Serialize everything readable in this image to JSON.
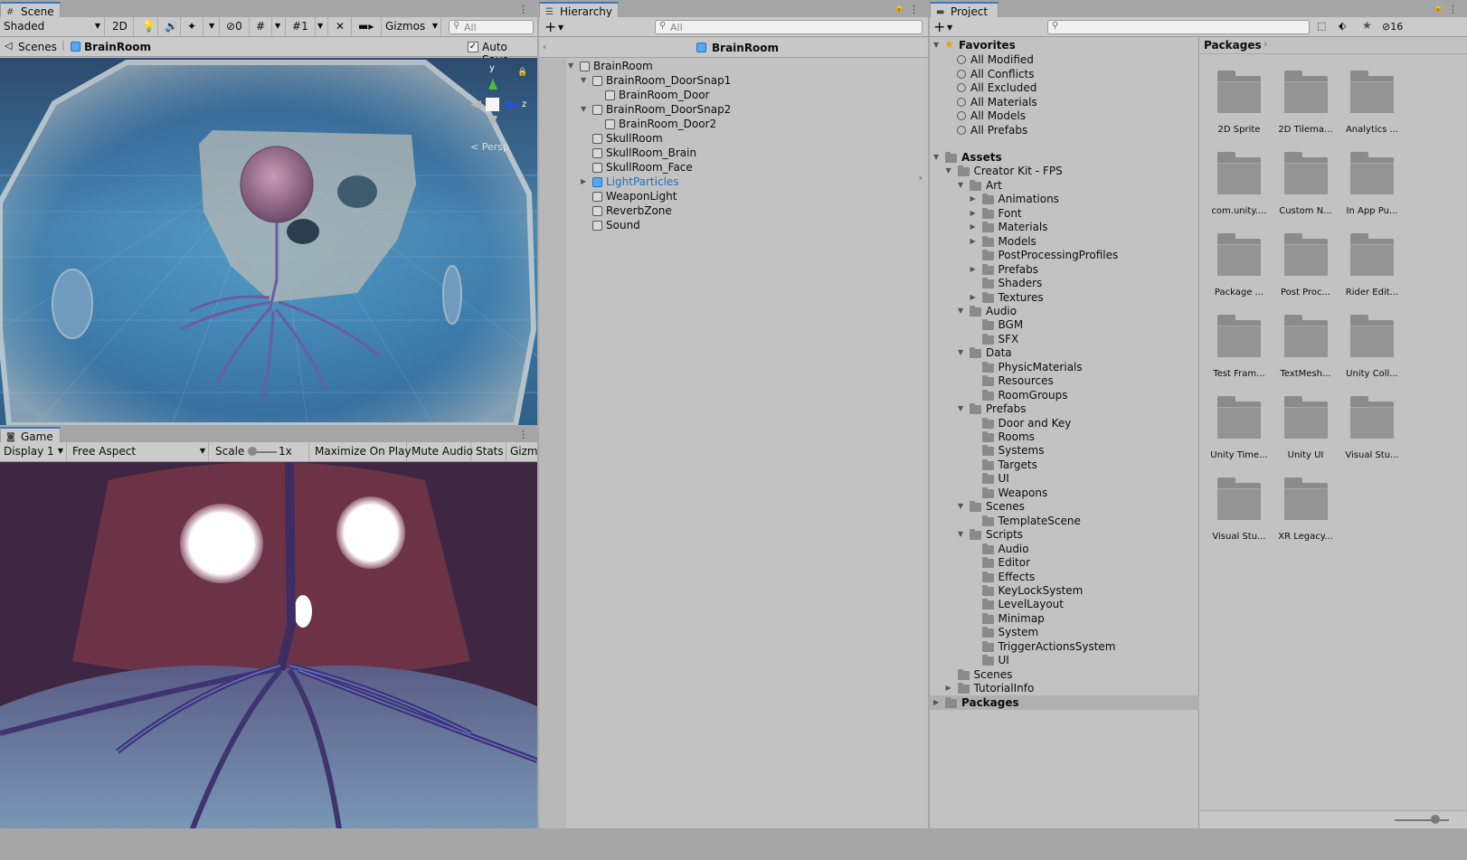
{
  "scene": {
    "tab": "Scene",
    "shading": "Shaded",
    "mode2d": "2D",
    "hidden_count": "0",
    "grid_count": "1",
    "gizmos": "Gizmos",
    "search_placeholder": "All",
    "breadcrumb_root": "Scenes",
    "breadcrumb_current": "BrainRoom",
    "autosave_label": "Auto Save",
    "autosave_checked": true,
    "persp_label": "Persp",
    "axis_y": "y",
    "axis_z": "z"
  },
  "game": {
    "tab": "Game",
    "display": "Display 1",
    "aspect": "Free Aspect",
    "scale_label": "Scale",
    "scale_value": "1x",
    "maximize": "Maximize On Play",
    "mute": "Mute Audio",
    "stats": "Stats",
    "gizmos": "Gizmo"
  },
  "hierarchy": {
    "tab": "Hierarchy",
    "add": "+",
    "search_placeholder": "All",
    "scene_title": "BrainRoom",
    "items": [
      {
        "label": "BrainRoom",
        "depth": 0,
        "expanded": true,
        "selected": false
      },
      {
        "label": "BrainRoom_DoorSnap1",
        "depth": 1,
        "expanded": true,
        "selected": false
      },
      {
        "label": "BrainRoom_Door",
        "depth": 2,
        "expanded": null,
        "selected": false
      },
      {
        "label": "BrainRoom_DoorSnap2",
        "depth": 1,
        "expanded": true,
        "selected": false
      },
      {
        "label": "BrainRoom_Door2",
        "depth": 2,
        "expanded": null,
        "selected": false
      },
      {
        "label": "SkullRoom",
        "depth": 1,
        "expanded": null,
        "selected": false
      },
      {
        "label": "SkullRoom_Brain",
        "depth": 1,
        "expanded": null,
        "selected": false
      },
      {
        "label": "SkullRoom_Face",
        "depth": 1,
        "expanded": null,
        "selected": false
      },
      {
        "label": "LightParticles",
        "depth": 1,
        "expanded": false,
        "selected": true
      },
      {
        "label": "WeaponLight",
        "depth": 1,
        "expanded": null,
        "selected": false
      },
      {
        "label": "ReverbZone",
        "depth": 1,
        "expanded": null,
        "selected": false
      },
      {
        "label": "Sound",
        "depth": 1,
        "expanded": null,
        "selected": false
      }
    ]
  },
  "project": {
    "tab": "Project",
    "add": "+",
    "hidden_count": "16",
    "favorites_label": "Favorites",
    "favorites": [
      "All Modified",
      "All Conflicts",
      "All Excluded",
      "All Materials",
      "All Models",
      "All Prefabs"
    ],
    "tree": [
      {
        "label": "Assets",
        "depth": 0,
        "expanded": true,
        "bold": true
      },
      {
        "label": "Creator Kit - FPS",
        "depth": 1,
        "expanded": true
      },
      {
        "label": "Art",
        "depth": 2,
        "expanded": true
      },
      {
        "label": "Animations",
        "depth": 3,
        "expanded": false
      },
      {
        "label": "Font",
        "depth": 3,
        "expanded": false
      },
      {
        "label": "Materials",
        "depth": 3,
        "expanded": false
      },
      {
        "label": "Models",
        "depth": 3,
        "expanded": false
      },
      {
        "label": "PostProcessingProfiles",
        "depth": 3,
        "expanded": null
      },
      {
        "label": "Prefabs",
        "depth": 3,
        "expanded": false
      },
      {
        "label": "Shaders",
        "depth": 3,
        "expanded": null
      },
      {
        "label": "Textures",
        "depth": 3,
        "expanded": false
      },
      {
        "label": "Audio",
        "depth": 2,
        "expanded": true
      },
      {
        "label": "BGM",
        "depth": 3,
        "expanded": null
      },
      {
        "label": "SFX",
        "depth": 3,
        "expanded": null
      },
      {
        "label": "Data",
        "depth": 2,
        "expanded": true
      },
      {
        "label": "PhysicMaterials",
        "depth": 3,
        "expanded": null
      },
      {
        "label": "Resources",
        "depth": 3,
        "expanded": null
      },
      {
        "label": "RoomGroups",
        "depth": 3,
        "expanded": null
      },
      {
        "label": "Prefabs",
        "depth": 2,
        "expanded": true
      },
      {
        "label": "Door and Key",
        "depth": 3,
        "expanded": null
      },
      {
        "label": "Rooms",
        "depth": 3,
        "expanded": null
      },
      {
        "label": "Systems",
        "depth": 3,
        "expanded": null
      },
      {
        "label": "Targets",
        "depth": 3,
        "expanded": null
      },
      {
        "label": "UI",
        "depth": 3,
        "expanded": null
      },
      {
        "label": "Weapons",
        "depth": 3,
        "expanded": null
      },
      {
        "label": "Scenes",
        "depth": 2,
        "expanded": true
      },
      {
        "label": "TemplateScene",
        "depth": 3,
        "expanded": null
      },
      {
        "label": "Scripts",
        "depth": 2,
        "expanded": true
      },
      {
        "label": "Audio",
        "depth": 3,
        "expanded": null
      },
      {
        "label": "Editor",
        "depth": 3,
        "expanded": null
      },
      {
        "label": "Effects",
        "depth": 3,
        "expanded": null
      },
      {
        "label": "KeyLockSystem",
        "depth": 3,
        "expanded": null
      },
      {
        "label": "LevelLayout",
        "depth": 3,
        "expanded": null
      },
      {
        "label": "Minimap",
        "depth": 3,
        "expanded": null
      },
      {
        "label": "System",
        "depth": 3,
        "expanded": null
      },
      {
        "label": "TriggerActionsSystem",
        "depth": 3,
        "expanded": null
      },
      {
        "label": "UI",
        "depth": 3,
        "expanded": null
      },
      {
        "label": "Scenes",
        "depth": 1,
        "expanded": null
      },
      {
        "label": "TutorialInfo",
        "depth": 1,
        "expanded": false
      },
      {
        "label": "Packages",
        "depth": 0,
        "expanded": false,
        "bold": true,
        "selected": true
      }
    ],
    "grid_title": "Packages",
    "grid": [
      "2D Sprite",
      "2D Tilema...",
      "Analytics ...",
      "com.unity....",
      "Custom N...",
      "In App Pu...",
      "Package ...",
      "Post Proc...",
      "Rider Edit...",
      "Test Fram...",
      "TextMesh...",
      "Unity Coll...",
      "Unity Time...",
      "Unity UI",
      "Visual Stu...",
      "Visual Stu...",
      "XR Legacy..."
    ]
  }
}
